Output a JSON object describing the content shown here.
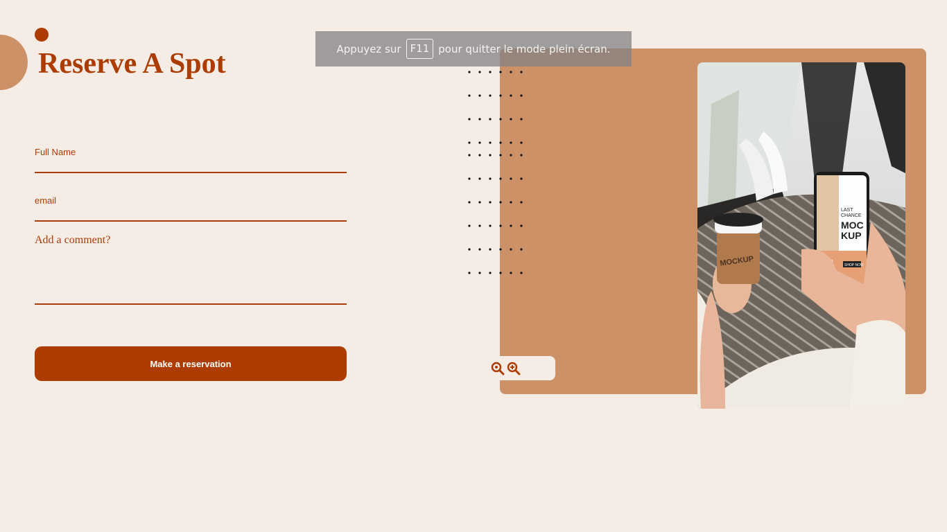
{
  "page": {
    "title": "Reserve A Spot"
  },
  "form": {
    "full_name_label": "Full Name",
    "full_name_value": "",
    "email_label": "email",
    "email_value": "",
    "comment_placeholder": "Add a comment?",
    "submit_label": "Make a reservation"
  },
  "fullscreen_notice": {
    "before": "Appuyez sur",
    "key": "F11",
    "after": "pour quitter le mode plein écran."
  },
  "image": {
    "cup_text": "MOCKUP",
    "phone_text_1": "LAST",
    "phone_text_2": "CHANCE",
    "phone_text_3": "MOC",
    "phone_text_4": "KUP",
    "phone_button": "SHOP NOW"
  },
  "icons": {
    "zoom_out": "zoom-pin-icon",
    "zoom_in": "zoom-in-icon"
  },
  "colors": {
    "accent": "#ad3c02",
    "panel": "#cd9168",
    "background": "#f5ece6"
  }
}
